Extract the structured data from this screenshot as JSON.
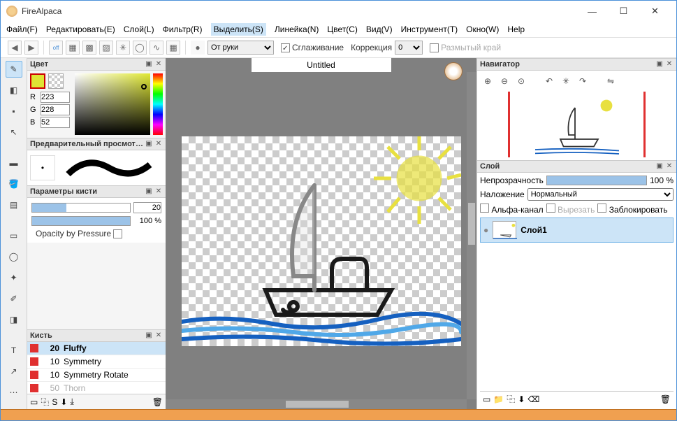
{
  "app": {
    "title": "FireAlpaca"
  },
  "win_controls": {
    "min": "—",
    "max": "☐",
    "close": "✕"
  },
  "menu": [
    "Файл(F)",
    "Редактировать(E)",
    "Слой(L)",
    "Фильтр(R)",
    "Выделить(S)",
    "Линейка(N)",
    "Цвет(C)",
    "Вид(V)",
    "Инструмент(T)",
    "Окно(W)",
    "Help"
  ],
  "menu_highlight_index": 4,
  "toolbar": {
    "freehand_label": "От руки",
    "smoothing_label": "Сглаживание",
    "correction_label": "Коррекция",
    "correction_value": "0",
    "blur_label": "Размытый край"
  },
  "tab": {
    "doc_title": "Untitled"
  },
  "panels": {
    "color": {
      "title": "Цвет",
      "r_label": "R",
      "r": "223",
      "g_label": "G",
      "g": "228",
      "b_label": "B",
      "b": "52"
    },
    "preview": {
      "title": "Предварительный просмотр..."
    },
    "brush_params": {
      "title": "Параметры кисти",
      "size_value": "20",
      "opacity_value": "100 %",
      "opacity_by_pressure": "Opacity by Pressure"
    },
    "brushes": {
      "title": "Кисть",
      "items": [
        {
          "size": "20",
          "name": "Fluffy",
          "sel": true
        },
        {
          "size": "10",
          "name": "Symmetry",
          "sel": false
        },
        {
          "size": "10",
          "name": "Symmetry Rotate",
          "sel": false
        },
        {
          "size": "50",
          "name": "Thorn",
          "sel": false
        }
      ]
    },
    "navigator": {
      "title": "Навигатор"
    },
    "layer": {
      "title": "Слой",
      "opacity_label": "Непрозрачность",
      "opacity_value": "100 %",
      "blend_label": "Наложение",
      "blend_value": "Нормальный",
      "alpha_label": "Альфа-канал",
      "cut_label": "Вырезать",
      "lock_label": "Заблокировать",
      "layer1": "Слой1"
    }
  }
}
